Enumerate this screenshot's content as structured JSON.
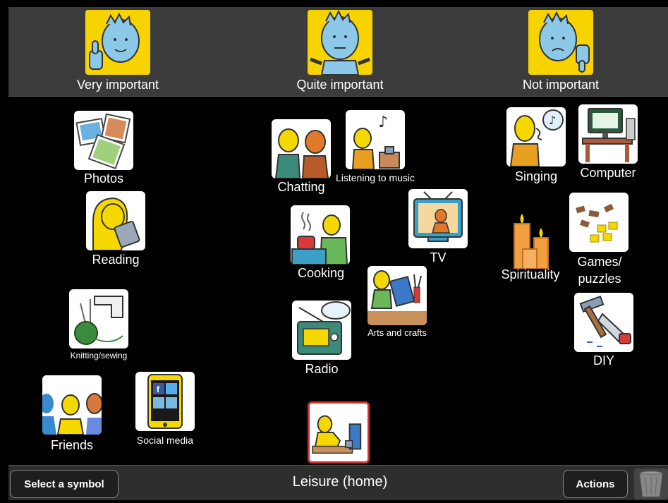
{
  "header": {
    "columns": [
      {
        "label": "Very important",
        "icon": "thumbs-up-face-icon"
      },
      {
        "label": "Quite important",
        "icon": "shrug-face-icon"
      },
      {
        "label": "Not important",
        "icon": "thumbs-down-face-icon"
      }
    ]
  },
  "symbols": [
    {
      "label": "Photos",
      "icon": "photos-icon"
    },
    {
      "label": "Reading",
      "icon": "reading-icon"
    },
    {
      "label": "Knitting/sewing",
      "icon": "knitting-sewing-icon"
    },
    {
      "label": "Friends",
      "icon": "friends-icon"
    },
    {
      "label": "Social media",
      "icon": "social-media-icon"
    },
    {
      "label": "Chatting",
      "icon": "chatting-icon"
    },
    {
      "label": "Listening to music",
      "icon": "listening-music-icon"
    },
    {
      "label": "TV",
      "icon": "tv-icon"
    },
    {
      "label": "Cooking",
      "icon": "cooking-icon"
    },
    {
      "label": "Arts and crafts",
      "icon": "arts-crafts-icon"
    },
    {
      "label": "Radio",
      "icon": "radio-icon"
    },
    {
      "label": "Singing",
      "icon": "singing-icon"
    },
    {
      "label": "Computer",
      "icon": "computer-icon"
    },
    {
      "label": "Spirituality",
      "icon": "spirituality-icon"
    },
    {
      "label": "Games/ puzzles",
      "icon": "games-puzzles-icon"
    },
    {
      "label": "DIY",
      "icon": "diy-icon"
    }
  ],
  "selected_symbol": {
    "icon": "leisure-home-icon",
    "border_color": "#d32f2f"
  },
  "footer": {
    "select_button": "Select a symbol",
    "title": "Leisure (home)",
    "actions_button": "Actions",
    "trash_icon": "trash-icon"
  },
  "colors": {
    "header_bg": "#3b3b3b",
    "face_bg": "#f7d400",
    "board_bg": "#000000",
    "accent_red": "#d32f2f"
  }
}
